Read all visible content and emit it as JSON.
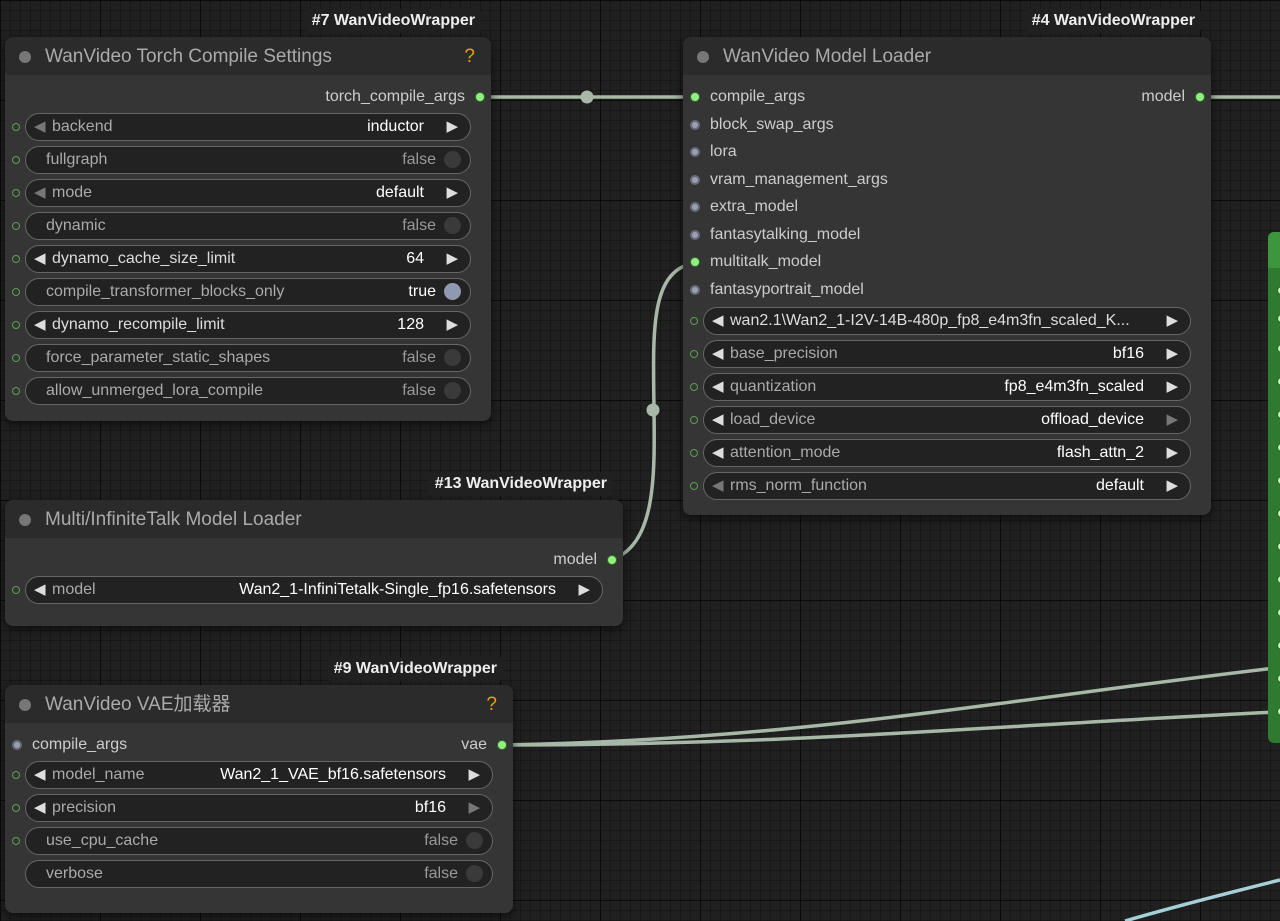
{
  "nodes": {
    "compile": {
      "badge": "#7 WanVideoWrapper",
      "title": "WanVideo Torch Compile Settings",
      "help": "?",
      "output": "torch_compile_args",
      "widgets": [
        {
          "label": "backend",
          "value": "inductor"
        },
        {
          "label": "fullgraph",
          "value": "false"
        },
        {
          "label": "mode",
          "value": "default"
        },
        {
          "label": "dynamic",
          "value": "false"
        },
        {
          "label": "dynamo_cache_size_limit",
          "value": "64"
        },
        {
          "label": "compile_transformer_blocks_only",
          "value": "true"
        },
        {
          "label": "dynamo_recompile_limit",
          "value": "128"
        },
        {
          "label": "force_parameter_static_shapes",
          "value": "false"
        },
        {
          "label": "allow_unmerged_lora_compile",
          "value": "false"
        }
      ]
    },
    "model_loader": {
      "badge": "#4 WanVideoWrapper",
      "title": "WanVideo Model Loader",
      "output": "model",
      "inputs": [
        "compile_args",
        "block_swap_args",
        "lora",
        "vram_management_args",
        "extra_model",
        "fantasytalking_model",
        "multitalk_model",
        "fantasyportrait_model"
      ],
      "widgets": [
        {
          "label": "",
          "value": "wan2.1\\Wan2_1-I2V-14B-480p_fp8_e4m3fn_scaled_K..."
        },
        {
          "label": "base_precision",
          "value": "bf16"
        },
        {
          "label": "quantization",
          "value": "fp8_e4m3fn_scaled"
        },
        {
          "label": "load_device",
          "value": "offload_device"
        },
        {
          "label": "attention_mode",
          "value": "flash_attn_2"
        },
        {
          "label": "rms_norm_function",
          "value": "default"
        }
      ]
    },
    "multitalk": {
      "badge": "#13 WanVideoWrapper",
      "title": "Multi/InfiniteTalk Model Loader",
      "output": "model",
      "widgets": [
        {
          "label": "model",
          "value": "Wan2_1-InfiniTetalk-Single_fp16.safetensors"
        }
      ]
    },
    "vae": {
      "badge": "#9 WanVideoWrapper",
      "title": "WanVideo VAE加载器",
      "help": "?",
      "input": "compile_args",
      "output": "vae",
      "widgets": [
        {
          "label": "model_name",
          "value": "Wan2_1_VAE_bf16.safetensors"
        },
        {
          "label": "precision",
          "value": "bf16"
        },
        {
          "label": "use_cpu_cache",
          "value": "false"
        },
        {
          "label": "verbose",
          "value": "false"
        }
      ]
    }
  },
  "colors": {
    "canvas": "#202020",
    "node_body": "#353535",
    "node_title": "#2b2b2b",
    "wire": "#a8b8a8",
    "wire_blue": "#a6d0d8",
    "socket_green": "#8ff07e",
    "help": "#e8a010",
    "green_node": "#2e7a2e"
  }
}
